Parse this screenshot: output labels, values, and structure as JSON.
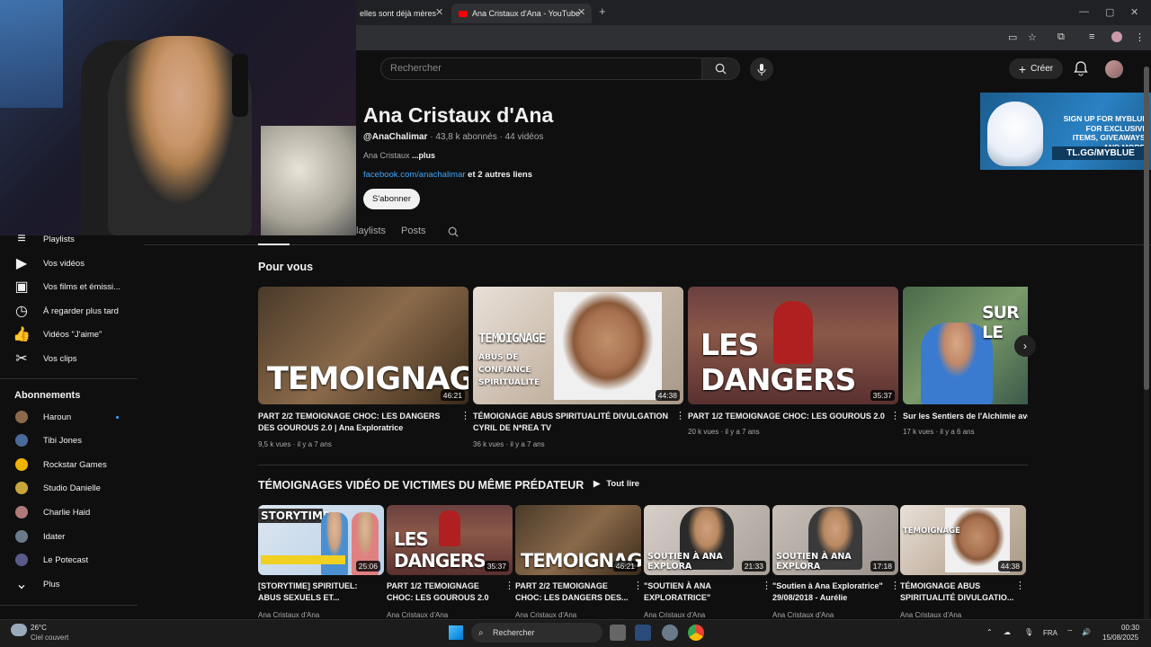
{
  "browser": {
    "tabs": [
      {
        "label": "elles sont déjà mères"
      },
      {
        "label": "Ana Cristaux d'Ana - YouTube"
      }
    ],
    "new_tab": "+"
  },
  "yt_header": {
    "search_placeholder": "Rechercher",
    "create_label": "Créer"
  },
  "channel": {
    "name": "Ana Cristaux d'Ana",
    "handle": "@AnaChalimar",
    "stats": " · 43,8 k abonnés · 44 vidéos",
    "description": "Ana Cristaux ",
    "more": "...plus",
    "link": "facebook.com/anachalimar",
    "link_suffix": " et 2 autres liens",
    "subscribe_label": "S'abonner"
  },
  "ad": {
    "text": "SIGN UP FOR MYBLUE FOR EXCLUSIVE ITEMS, GIVEAWAYS, AND MORE!",
    "cta": "TL.GG/MYBLUE"
  },
  "channel_tabs": [
    "laylists",
    "Posts"
  ],
  "sidebar": {
    "items": [
      {
        "label": "Playlists",
        "icon": "playlists-icon"
      },
      {
        "label": "Vos vidéos",
        "icon": "your-videos-icon"
      },
      {
        "label": "Vos films et émissi...",
        "icon": "movies-icon"
      },
      {
        "label": "À regarder plus tard",
        "icon": "watch-later-icon"
      },
      {
        "label": "Vidéos \"J'aime\"",
        "icon": "like-icon"
      },
      {
        "label": "Vos clips",
        "icon": "clips-icon"
      }
    ],
    "subs_heading": "Abonnements",
    "subs": [
      {
        "label": "Haroun",
        "color": "#8a6a4a",
        "live": true
      },
      {
        "label": "Tibi Jones",
        "color": "#4a6a9a",
        "live": false
      },
      {
        "label": "Rockstar Games",
        "color": "#f0b400",
        "live": false
      },
      {
        "label": "Studio Danielle",
        "color": "#c9a63a",
        "live": false
      },
      {
        "label": "Charlie Haid",
        "color": "#b07a7a",
        "live": false
      },
      {
        "label": "Idater",
        "color": "#6a7a8a",
        "live": false
      },
      {
        "label": "Le Potecast",
        "color": "#5a5a8a",
        "live": false
      }
    ],
    "more_label": "Plus"
  },
  "for_you": {
    "title": "Pour vous",
    "videos": [
      {
        "thumb_text": "TEMOIGNAGE",
        "duration": "46:21",
        "title": "PART 2/2 TEMOIGNAGE CHOC: LES DANGERS DES GOUROUS 2.0 | Ana Exploratrice",
        "meta": "9,5 k vues · il y a 7 ans",
        "bg": "linear-gradient(135deg,#4a3a2a,#8a6a4a 50%,#3a2a1a)"
      },
      {
        "thumb_text": "TEMOIGNAGE",
        "thumb_sub": "ABUS DE CONFIANCE SPIRITUALITE",
        "duration": "44:38",
        "title": "TÉMOIGNAGE ABUS SPIRITUALITÉ DIVULGATION CYRIL DE N*REA TV",
        "meta": "36 k vues · il y a 7 ans",
        "bg": "linear-gradient(135deg,#e8e0d8,#c8b8a8 50%,#a89888)"
      },
      {
        "thumb_text": "LES DANGERS",
        "duration": "35:37",
        "title": "PART 1/2 TEMOIGNAGE CHOC: LES GOUROUS 2.0",
        "meta": "20 k vues · il y a 7 ans",
        "bg": "linear-gradient(135deg,#5a3a3a,#9a4a3a 50%,#4a2a2a)"
      },
      {
        "thumb_text": "SUR LE",
        "duration": "",
        "title": "Sur les Sentiers de l'Alchimie avec",
        "meta": "17 k vues · il y a 6 ans",
        "bg": "linear-gradient(135deg,#4a6a4a,#7a9a6a 50%,#3a5a4a)"
      }
    ]
  },
  "playlist": {
    "title": "TÉMOIGNAGES VIDÉO DE VICTIMES DU MÊME PRÉDATEUR",
    "play_all": "Tout lire",
    "videos": [
      {
        "thumb_text": "STORYTIME",
        "duration": "25:06",
        "title": "[STORYTIME] SPIRITUEL: ABUS SEXUELS ET...",
        "channel": "Ana Cristaux d'Ana",
        "bg": "linear-gradient(135deg,#dce6f0,#b8d0e8)"
      },
      {
        "thumb_text": "LES DANGERS",
        "duration": "35:37",
        "title": "PART 1/2 TEMOIGNAGE CHOC: LES GOUROUS 2.0",
        "channel": "Ana Cristaux d'Ana",
        "bg": "linear-gradient(135deg,#5a3a3a,#9a4a3a 50%,#4a2a2a)"
      },
      {
        "thumb_text": "TEMOIGNAGE",
        "duration": "46:21",
        "title": "PART 2/2 TEMOIGNAGE CHOC: LES DANGERS DES...",
        "channel": "Ana Cristaux d'Ana",
        "bg": "linear-gradient(135deg,#4a3a2a,#8a6a4a 50%,#3a2a1a)"
      },
      {
        "thumb_text": "SOUTIEN À ANA EXPLORA",
        "duration": "21:33",
        "title": "\"SOUTIEN À ANA EXPLORATRICE\" CHRISTEL...",
        "channel": "Ana Cristaux d'Ana",
        "bg": "linear-gradient(135deg,#d8d0c8,#a8a098)"
      },
      {
        "thumb_text": "SOUTIEN À ANA EXPLORA",
        "duration": "17:18",
        "title": "\"Soutien à Ana Exploratrice\" 29/08/2018 - Aurélie",
        "channel": "Ana Cristaux d'Ana",
        "bg": "linear-gradient(135deg,#c8c0b8,#989088)"
      },
      {
        "thumb_text": "TEMOIGNAGE",
        "duration": "44:38",
        "title": "TÉMOIGNAGE ABUS SPIRITUALITÉ DIVULGATIO...",
        "channel": "Ana Cristaux d'Ana",
        "bg": "linear-gradient(135deg,#e8e0d8,#c8b8a8 50%,#a89888)"
      }
    ]
  },
  "taskbar": {
    "weather_temp": "26°C",
    "weather_desc": "Ciel couvert",
    "search": "Rechercher",
    "lang": "FRA",
    "time": "00:30",
    "date": "15/08/2025"
  }
}
